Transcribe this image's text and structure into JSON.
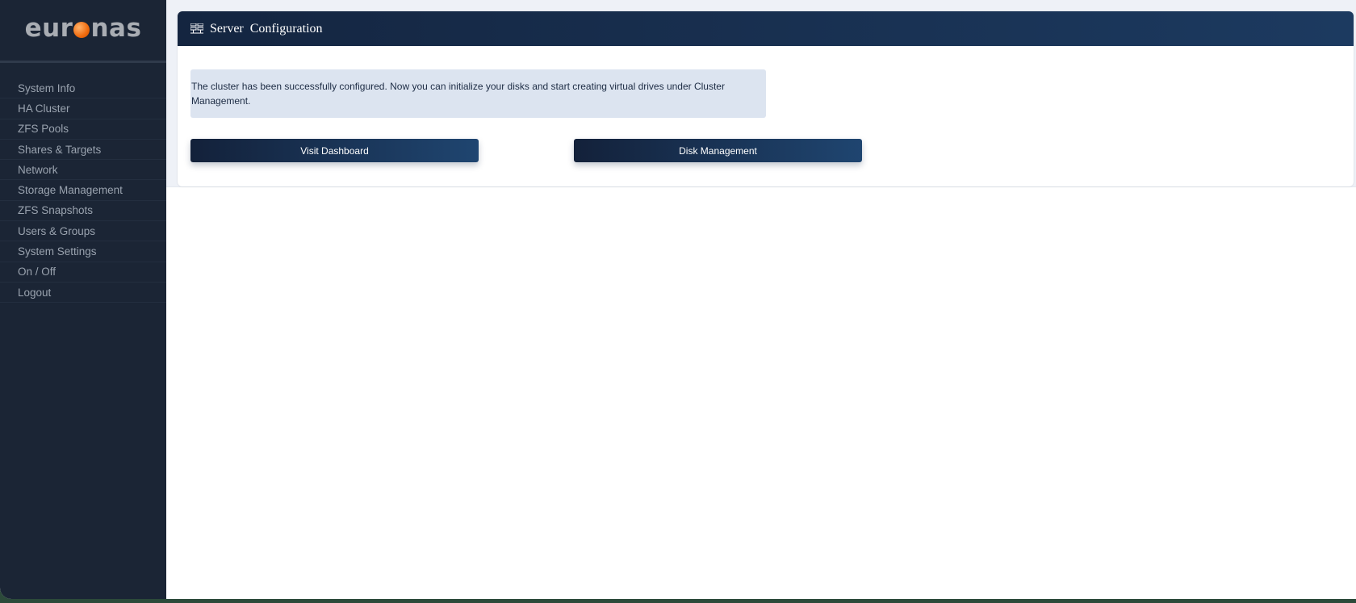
{
  "brand": {
    "logo_prefix": "eur",
    "logo_suffix": "nas",
    "logo_alt": "euronas",
    "accent": "#f06b0e"
  },
  "sidebar": {
    "items": [
      {
        "label": "System Info"
      },
      {
        "label": "HA Cluster"
      },
      {
        "label": "ZFS Pools"
      },
      {
        "label": "Shares & Targets"
      },
      {
        "label": "Network"
      },
      {
        "label": "Storage Management"
      },
      {
        "label": "ZFS Snapshots"
      },
      {
        "label": "Users & Groups"
      },
      {
        "label": "System Settings"
      },
      {
        "label": "On / Off"
      },
      {
        "label": "Logout"
      }
    ]
  },
  "panel": {
    "icon": "server-icon",
    "title": "Server Configuration",
    "message": "The cluster has been successfully configured. Now you can initialize your disks and start creating virtual drives under Cluster Management.",
    "buttons": {
      "dashboard_label": "Visit Dashboard",
      "disk_label": "Disk Management"
    }
  },
  "colors": {
    "sidebar_bg": "#1b2535",
    "header_gradient_start": "#142540",
    "header_gradient_end": "#1c3a60",
    "notice_bg": "#dce4f0"
  }
}
